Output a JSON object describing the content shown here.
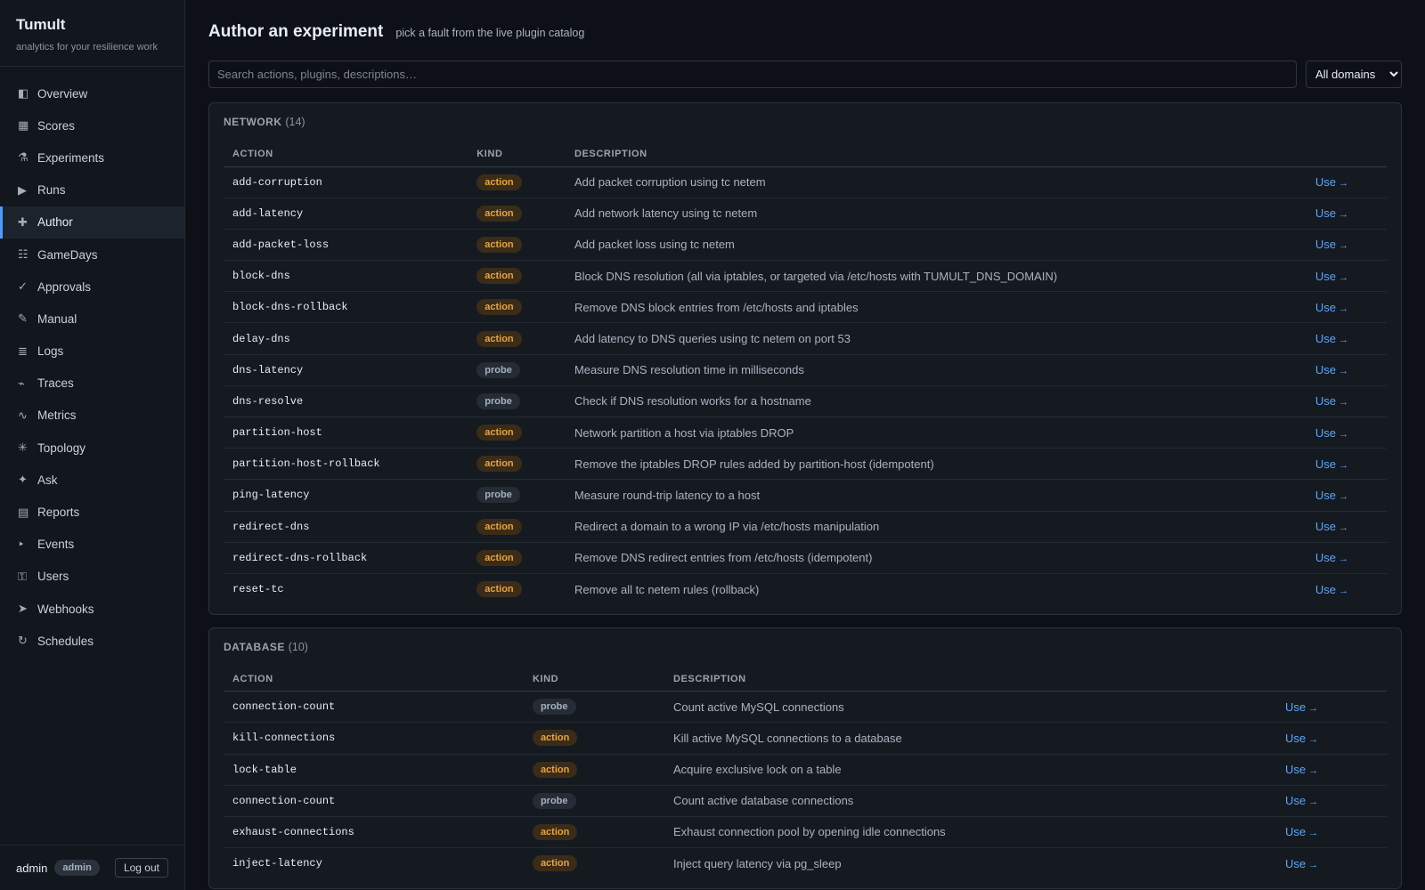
{
  "app": {
    "title": "Tumult",
    "subtitle": "analytics for your resilience work"
  },
  "sidebar": {
    "items": [
      {
        "label": "Overview",
        "icon": "◧",
        "icon_name": "overview-icon"
      },
      {
        "label": "Scores",
        "icon": "▦",
        "icon_name": "scores-icon"
      },
      {
        "label": "Experiments",
        "icon": "⚗",
        "icon_name": "flask-icon"
      },
      {
        "label": "Runs",
        "icon": "▶",
        "icon_name": "play-icon"
      },
      {
        "label": "Author",
        "icon": "✚",
        "icon_name": "plus-icon",
        "active": true
      },
      {
        "label": "GameDays",
        "icon": "☷",
        "icon_name": "calendar-icon"
      },
      {
        "label": "Approvals",
        "icon": "✓",
        "icon_name": "check-icon"
      },
      {
        "label": "Manual",
        "icon": "✎",
        "icon_name": "pencil-icon"
      },
      {
        "label": "Logs",
        "icon": "≣",
        "icon_name": "logs-icon"
      },
      {
        "label": "Traces",
        "icon": "⌁",
        "icon_name": "traces-icon"
      },
      {
        "label": "Metrics",
        "icon": "∿",
        "icon_name": "metrics-icon"
      },
      {
        "label": "Topology",
        "icon": "✳",
        "icon_name": "topology-icon"
      },
      {
        "label": "Ask",
        "icon": "✦",
        "icon_name": "sparkle-icon"
      },
      {
        "label": "Reports",
        "icon": "▤",
        "icon_name": "reports-icon"
      },
      {
        "label": "Events",
        "icon": "‣",
        "icon_name": "events-icon"
      },
      {
        "label": "Users",
        "icon": "⚿",
        "icon_name": "key-icon"
      },
      {
        "label": "Webhooks",
        "icon": "➤",
        "icon_name": "send-icon"
      },
      {
        "label": "Schedules",
        "icon": "↻",
        "icon_name": "refresh-icon"
      }
    ],
    "footer": {
      "user": "admin",
      "role": "admin",
      "logout_label": "Log out"
    }
  },
  "header": {
    "title": "Author an experiment",
    "subtitle": "pick a fault from the live plugin catalog"
  },
  "search": {
    "placeholder": "Search actions, plugins, descriptions…",
    "value": ""
  },
  "domain_filter": {
    "selected": "All domains"
  },
  "columns": {
    "action": "ACTION",
    "kind": "KIND",
    "description": "DESCRIPTION"
  },
  "use_label": "Use",
  "use_arrow": "→",
  "sections": [
    {
      "name": "NETWORK",
      "count": "(14)",
      "rows": [
        {
          "action": "add-corruption",
          "kind": "action",
          "description": "Add packet corruption using tc netem"
        },
        {
          "action": "add-latency",
          "kind": "action",
          "description": "Add network latency using tc netem"
        },
        {
          "action": "add-packet-loss",
          "kind": "action",
          "description": "Add packet loss using tc netem"
        },
        {
          "action": "block-dns",
          "kind": "action",
          "description": "Block DNS resolution (all via iptables, or targeted via /etc/hosts with TUMULT_DNS_DOMAIN)"
        },
        {
          "action": "block-dns-rollback",
          "kind": "action",
          "description": "Remove DNS block entries from /etc/hosts and iptables"
        },
        {
          "action": "delay-dns",
          "kind": "action",
          "description": "Add latency to DNS queries using tc netem on port 53"
        },
        {
          "action": "dns-latency",
          "kind": "probe",
          "description": "Measure DNS resolution time in milliseconds"
        },
        {
          "action": "dns-resolve",
          "kind": "probe",
          "description": "Check if DNS resolution works for a hostname"
        },
        {
          "action": "partition-host",
          "kind": "action",
          "description": "Network partition a host via iptables DROP"
        },
        {
          "action": "partition-host-rollback",
          "kind": "action",
          "description": "Remove the iptables DROP rules added by partition-host (idempotent)"
        },
        {
          "action": "ping-latency",
          "kind": "probe",
          "description": "Measure round-trip latency to a host"
        },
        {
          "action": "redirect-dns",
          "kind": "action",
          "description": "Redirect a domain to a wrong IP via /etc/hosts manipulation"
        },
        {
          "action": "redirect-dns-rollback",
          "kind": "action",
          "description": "Remove DNS redirect entries from /etc/hosts (idempotent)"
        },
        {
          "action": "reset-tc",
          "kind": "action",
          "description": "Remove all tc netem rules (rollback)"
        }
      ]
    },
    {
      "name": "DATABASE",
      "count": "(10)",
      "rows": [
        {
          "action": "connection-count",
          "kind": "probe",
          "description": "Count active MySQL connections"
        },
        {
          "action": "kill-connections",
          "kind": "action",
          "description": "Kill active MySQL connections to a database"
        },
        {
          "action": "lock-table",
          "kind": "action",
          "description": "Acquire exclusive lock on a table"
        },
        {
          "action": "connection-count",
          "kind": "probe",
          "description": "Count active database connections"
        },
        {
          "action": "exhaust-connections",
          "kind": "action",
          "description": "Exhaust connection pool by opening idle connections"
        },
        {
          "action": "inject-latency",
          "kind": "action",
          "description": "Inject query latency via pg_sleep"
        }
      ]
    }
  ]
}
